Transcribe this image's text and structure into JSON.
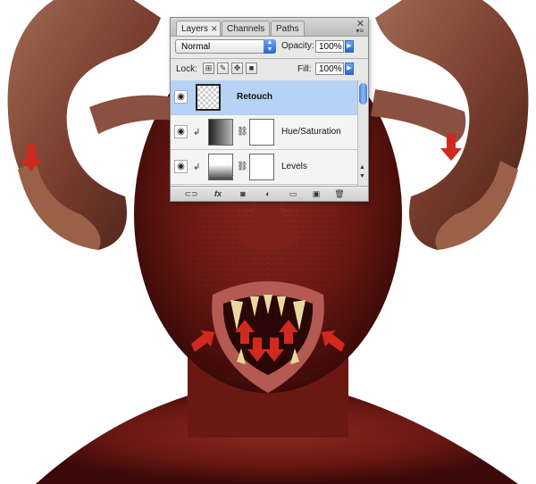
{
  "panel": {
    "tabs": [
      {
        "label": "Layers",
        "active": true
      },
      {
        "label": "Channels",
        "active": false
      },
      {
        "label": "Paths",
        "active": false
      }
    ],
    "close_glyph": "✕",
    "menu_glyph": "▾≡",
    "blend_mode": "Normal",
    "opacity_label": "Opacity:",
    "opacity_value": "100%",
    "lock_label": "Lock:",
    "fill_label": "Fill:",
    "fill_value": "100%"
  },
  "layers": [
    {
      "name": "Retouch",
      "selected": true,
      "visible": true,
      "type": "pixel"
    },
    {
      "name": "Hue/Saturation",
      "selected": false,
      "visible": true,
      "type": "adjustment-hue",
      "clipped": true
    },
    {
      "name": "Levels",
      "selected": false,
      "visible": true,
      "type": "adjustment-levels",
      "clipped": true
    }
  ],
  "bottom_icons": [
    "link-layers-icon",
    "fx-icon",
    "layer-mask-icon",
    "adjustment-layer-icon",
    "group-folder-icon",
    "new-layer-icon",
    "trash-icon"
  ],
  "bottom_glyphs": {
    "link": "⊂⊃",
    "fx": "fx",
    "mask": "◙",
    "adjust": "◐",
    "group": "▭",
    "new": "▣",
    "trash": "🗑"
  },
  "colors": {
    "accent": "#3a78d8",
    "selected_row": "#b6d2f5",
    "arrow_red": "#d02a1e",
    "skin": "#7a1c14"
  },
  "artwork": {
    "subject": "demon-face-with-ram-horns",
    "annotation_arrows": 8
  }
}
